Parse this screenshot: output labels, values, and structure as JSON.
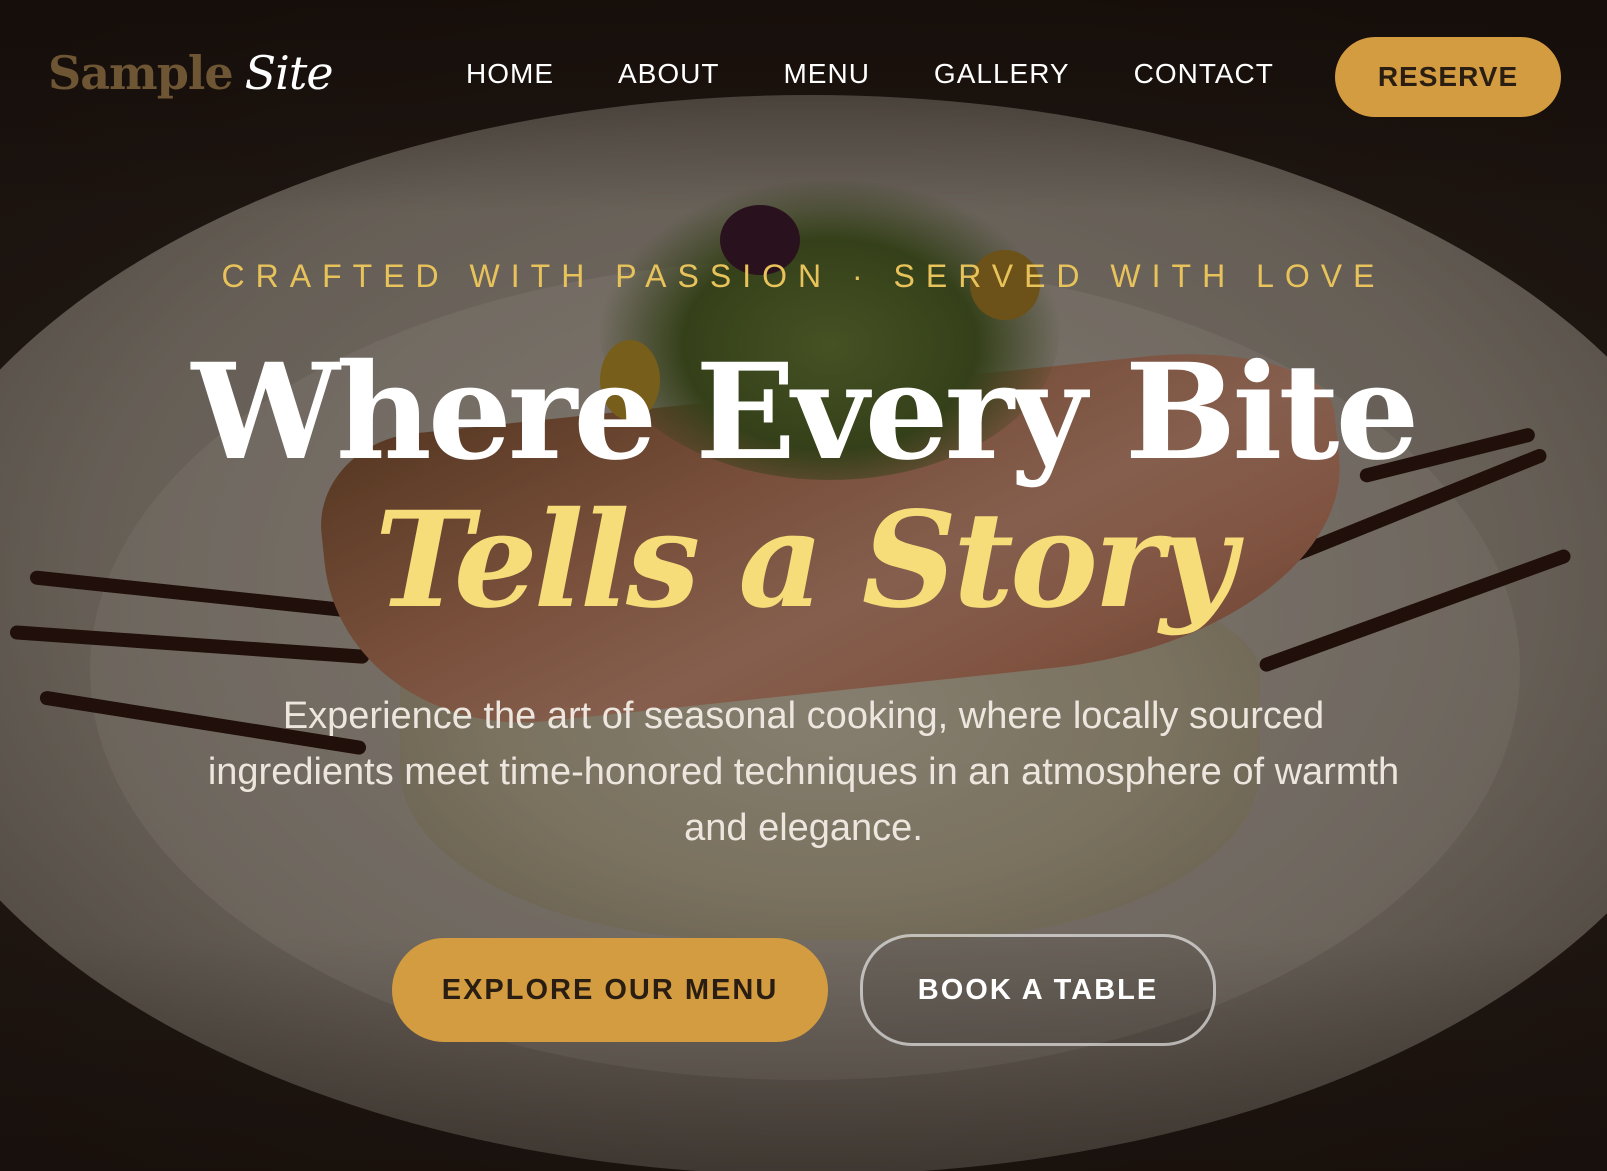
{
  "brand": {
    "logo_part1": "Sample",
    "logo_part2": "Site"
  },
  "nav": {
    "items": [
      {
        "label": "HOME"
      },
      {
        "label": "ABOUT"
      },
      {
        "label": "MENU"
      },
      {
        "label": "GALLERY"
      },
      {
        "label": "CONTACT"
      }
    ],
    "reserve_label": "RESERVE"
  },
  "hero": {
    "tagline": "CRAFTED WITH PASSION · SERVED WITH LOVE",
    "headline_line1": "Where Every Bite",
    "headline_line2": "Tells a Story",
    "description": "Experience the art of seasonal cooking, where locally sourced ingredients meet time-honored techniques in an atmosphere of warmth and elegance.",
    "primary_cta": "EXPLORE OUR MENU",
    "secondary_cta": "BOOK A TABLE",
    "background_image": "plated-salmon-risotto-photo"
  },
  "colors": {
    "accent_gold": "#d39c40",
    "tagline_gold": "#e8c25a",
    "headline_italic": "#f7dc7a",
    "dark_text": "#2a1d12"
  }
}
